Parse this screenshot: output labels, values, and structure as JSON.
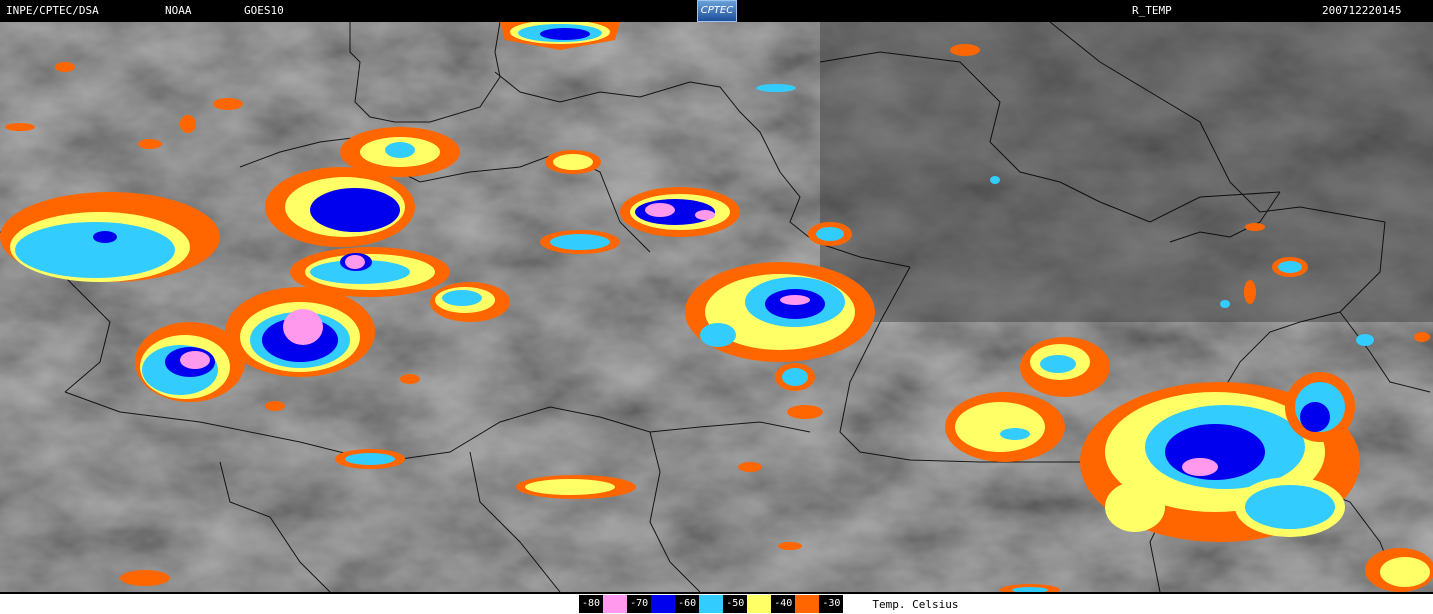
{
  "header": {
    "source": "INPE/CPTEC/DSA",
    "agency": "NOAA",
    "satellite": "GOES10",
    "logo_text": "CPTEC",
    "product": "R_TEMP",
    "datetime": "200712220145"
  },
  "legend": {
    "title": "Temp. Celsius",
    "items": [
      {
        "label": "-80",
        "color": "#ff99ee"
      },
      {
        "label": "-70",
        "color": "#0000ee"
      },
      {
        "label": "-60",
        "color": "#33ccff"
      },
      {
        "label": "-50",
        "color": "#ffff66"
      },
      {
        "label": "-40",
        "color": "#ff6600"
      },
      {
        "label": "-30",
        "color": "#ffffff"
      }
    ]
  }
}
